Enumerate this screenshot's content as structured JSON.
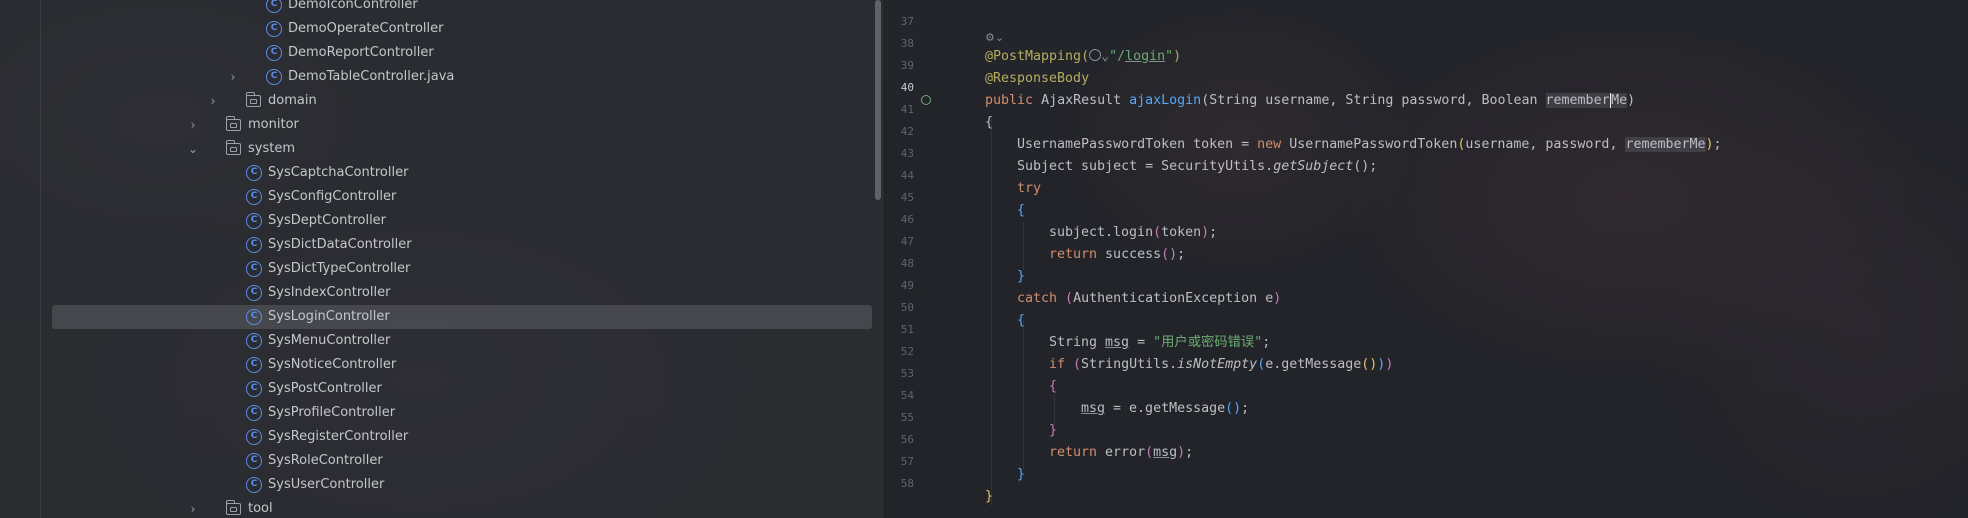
{
  "project_tree": {
    "items": [
      {
        "name": "DemoIconController",
        "type": "class",
        "level": 4,
        "expanded": null
      },
      {
        "name": "DemoOperateController",
        "type": "class",
        "level": 4,
        "expanded": null
      },
      {
        "name": "DemoReportController",
        "type": "class",
        "level": 4,
        "expanded": null
      },
      {
        "name": "DemoTableController.java",
        "type": "file-collapsed",
        "level": 4,
        "expanded": false
      },
      {
        "name": "domain",
        "type": "folder",
        "level": 3,
        "expanded": false
      },
      {
        "name": "monitor",
        "type": "folder",
        "level": 2,
        "expanded": false
      },
      {
        "name": "system",
        "type": "folder",
        "level": 2,
        "expanded": true
      },
      {
        "name": "SysCaptchaController",
        "type": "class",
        "level": 3,
        "expanded": null
      },
      {
        "name": "SysConfigController",
        "type": "class",
        "level": 3,
        "expanded": null
      },
      {
        "name": "SysDeptController",
        "type": "class",
        "level": 3,
        "expanded": null
      },
      {
        "name": "SysDictDataController",
        "type": "class",
        "level": 3,
        "expanded": null
      },
      {
        "name": "SysDictTypeController",
        "type": "class",
        "level": 3,
        "expanded": null
      },
      {
        "name": "SysIndexController",
        "type": "class",
        "level": 3,
        "expanded": null
      },
      {
        "name": "SysLoginController",
        "type": "class",
        "level": 3,
        "expanded": null,
        "selected": true
      },
      {
        "name": "SysMenuController",
        "type": "class",
        "level": 3,
        "expanded": null
      },
      {
        "name": "SysNoticeController",
        "type": "class",
        "level": 3,
        "expanded": null
      },
      {
        "name": "SysPostController",
        "type": "class",
        "level": 3,
        "expanded": null
      },
      {
        "name": "SysProfileController",
        "type": "class",
        "level": 3,
        "expanded": null
      },
      {
        "name": "SysRegisterController",
        "type": "class",
        "level": 3,
        "expanded": null
      },
      {
        "name": "SysRoleController",
        "type": "class",
        "level": 3,
        "expanded": null
      },
      {
        "name": "SysUserController",
        "type": "class",
        "level": 3,
        "expanded": null
      },
      {
        "name": "tool",
        "type": "folder",
        "level": 2,
        "expanded": false
      }
    ]
  },
  "editor": {
    "current_line": 40,
    "lines": [
      {
        "n": "37"
      },
      {
        "n": "38",
        "code": "@PostMapping(",
        "url": "\"/login\"",
        "tail": ")"
      },
      {
        "n": "39",
        "code": "@ResponseBody"
      },
      {
        "n": "40",
        "code": "public AjaxResult ajaxLogin(String username, String password, Boolean rememberMe)"
      },
      {
        "n": "41",
        "code": "{"
      },
      {
        "n": "42",
        "code": "UsernamePasswordToken token = new UsernamePasswordToken(username, password, rememberMe);"
      },
      {
        "n": "43",
        "code": "Subject subject = SecurityUtils.getSubject();"
      },
      {
        "n": "44",
        "code": "try"
      },
      {
        "n": "45",
        "code": "{"
      },
      {
        "n": "46",
        "code": "subject.login(token);"
      },
      {
        "n": "47",
        "code": "return success();"
      },
      {
        "n": "48",
        "code": "}"
      },
      {
        "n": "49",
        "code": "catch (AuthenticationException e)"
      },
      {
        "n": "50",
        "code": "{"
      },
      {
        "n": "51",
        "code": "String msg = \"用户或密码错误\";"
      },
      {
        "n": "52",
        "code": "if (StringUtils.isNotEmpty(e.getMessage()))"
      },
      {
        "n": "53",
        "code": "{"
      },
      {
        "n": "54",
        "code": "msg = e.getMessage();"
      },
      {
        "n": "55",
        "code": "}"
      },
      {
        "n": "56",
        "code": "return error(msg);"
      },
      {
        "n": "57",
        "code": "}"
      },
      {
        "n": "58",
        "code": "}"
      }
    ],
    "tokens": {
      "kw_public": "public",
      "type_ajax": "AjaxResult",
      "fn_ajaxLogin": "ajaxLogin",
      "p_string": "String",
      "p_username": "username",
      "p_password": "password",
      "p_boolean": "Boolean",
      "p_remember_a": "remember",
      "p_remember_b": "Me",
      "kw_new": "new",
      "kw_try": "try",
      "kw_catch": "catch",
      "kw_return": "return",
      "kw_if": "if",
      "str_msg": "\"用户或密码错误\""
    }
  },
  "colors": {
    "keyword": "#cf8e6d",
    "annotation": "#b3ae60",
    "function": "#56a8f5",
    "string": "#6aab73",
    "class_icon": "#5b8ee8"
  }
}
